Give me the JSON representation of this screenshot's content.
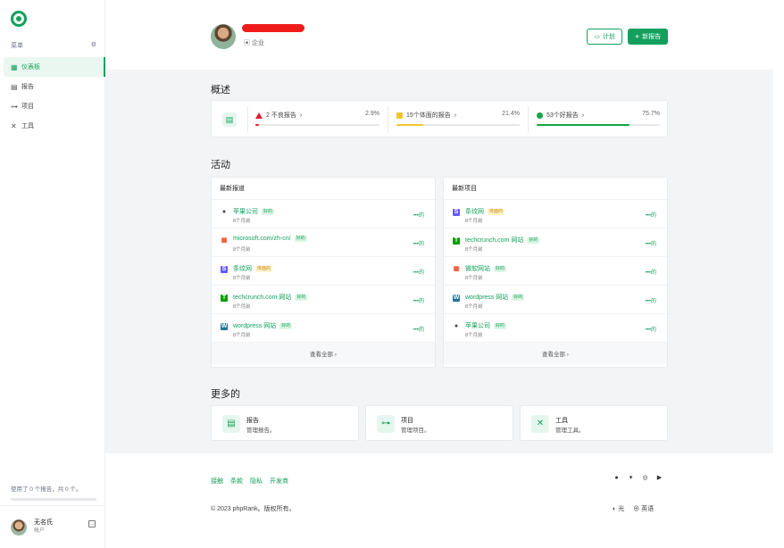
{
  "sidebar": {
    "menu_label": "菜单",
    "items": [
      {
        "label": "仪表板",
        "icon": "grid-icon"
      },
      {
        "label": "报告",
        "icon": "table-icon"
      },
      {
        "label": "项目",
        "icon": "project-icon"
      },
      {
        "label": "工具",
        "icon": "tools-icon"
      }
    ],
    "usage_text": "使用了 0 个报告，共 0 个。",
    "account": {
      "name": "无名氏",
      "role": "帐户"
    }
  },
  "header": {
    "org_label": "企业",
    "plan_button": "计划",
    "new_report_button": "新报告"
  },
  "overview": {
    "title": "概述",
    "stats": [
      {
        "label": "2 不良报告",
        "percent": "2.9%",
        "fill": 0.029,
        "color": "#e11d2e"
      },
      {
        "label": "15个体面的报告",
        "percent": "21.4%",
        "fill": 0.214,
        "color": "#f4c430"
      },
      {
        "label": "53个好报告",
        "percent": "75.7%",
        "fill": 0.757,
        "color": "#16a34a"
      }
    ]
  },
  "activity": {
    "title": "活动",
    "recent_reports": {
      "heading": "最新报道",
      "rows": [
        {
          "name": "苹果公司",
          "badge": "好的",
          "badge_type": "good",
          "time": "8个月前",
          "icon": "apple-icon"
        },
        {
          "name": "microsoft.com/zh-cn/",
          "badge": "好的",
          "badge_type": "good",
          "time": "8个月前",
          "icon": "microsoft-icon"
        },
        {
          "name": "条纹网",
          "badge": "体面的",
          "badge_type": "mid",
          "time": "8个月前",
          "icon": "stripe-icon"
        },
        {
          "name": "techcrunch.com 网站",
          "badge": "好的",
          "badge_type": "good",
          "time": "8个月前",
          "icon": "techcrunch-icon"
        },
        {
          "name": "wordpress 网站",
          "badge": "好的",
          "badge_type": "good",
          "time": "8个月前",
          "icon": "wordpress-icon"
        }
      ],
      "view_all": "查看全部 ›"
    },
    "recent_projects": {
      "heading": "最新项目",
      "rows": [
        {
          "name": "条纹网",
          "badge": "体面的",
          "badge_type": "mid",
          "time": "8个月前",
          "icon": "stripe-icon"
        },
        {
          "name": "techcrunch.com 网站",
          "badge": "好的",
          "badge_type": "good",
          "time": "8个月前",
          "icon": "techcrunch-icon"
        },
        {
          "name": "微软网站",
          "badge": "好的",
          "badge_type": "good",
          "time": "8个月前",
          "icon": "microsoft-icon"
        },
        {
          "name": "wordpress 网站",
          "badge": "好的",
          "badge_type": "good",
          "time": "8个月前",
          "icon": "wordpress-icon"
        },
        {
          "name": "苹果公司",
          "badge": "好的",
          "badge_type": "good",
          "time": "8个月前",
          "icon": "apple-icon"
        }
      ],
      "view_all": "查看全部 ›"
    },
    "more_label": "•••的"
  },
  "more": {
    "title": "更多的",
    "cards": [
      {
        "title": "报告",
        "subtitle": "管理报告。",
        "icon": "report-icon"
      },
      {
        "title": "项目",
        "subtitle": "管理项目。",
        "icon": "project-icon"
      },
      {
        "title": "工具",
        "subtitle": "管理工具。",
        "icon": "tools-icon"
      }
    ]
  },
  "footer": {
    "links": [
      "接触",
      "条款",
      "隐私",
      "开发商"
    ],
    "copyright": "© 2023 phpRank。版权所有。",
    "theme_label": "光",
    "language_label": "英语"
  }
}
